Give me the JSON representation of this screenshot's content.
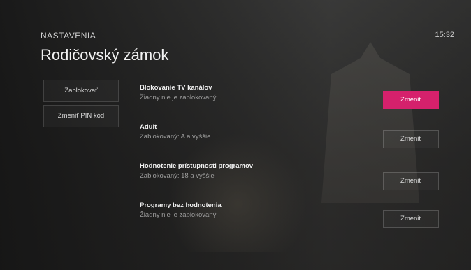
{
  "header": {
    "section": "NASTAVENIA",
    "title": "Rodičovský zámok",
    "clock": "15:32"
  },
  "left_menu": [
    {
      "label": "Zablokovať"
    },
    {
      "label": "Zmeniť PIN kód"
    }
  ],
  "settings": [
    {
      "title": "Blokovanie TV kanálov",
      "subtitle": "Žiadny nie je zablokovaný",
      "button": "Zmeniť",
      "active": true
    },
    {
      "title": "Adult",
      "subtitle": "Zablokovaný: A a vyššie",
      "button": "Zmeniť",
      "active": false
    },
    {
      "title": "Hodnotenie prístupnosti programov",
      "subtitle": "Zablokovaný: 18 a vyššie",
      "button": "Zmeniť",
      "active": false
    },
    {
      "title": "Programy bez hodnotenia",
      "subtitle": "Žiadny nie je zablokovaný",
      "button": "Zmeniť",
      "active": false
    }
  ],
  "colors": {
    "accent": "#d5216c"
  }
}
